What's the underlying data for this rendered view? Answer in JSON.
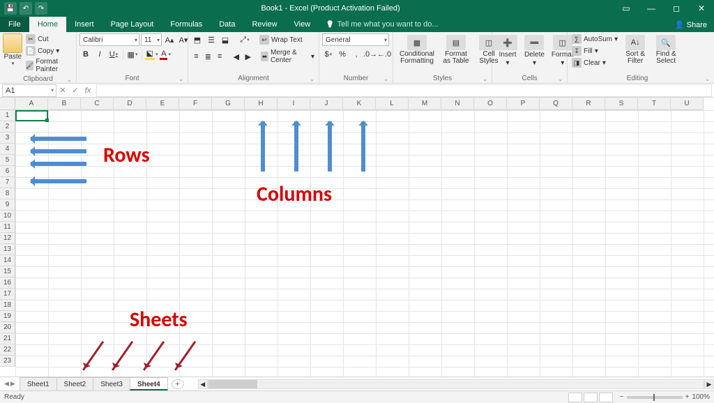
{
  "titlebar": {
    "title": "Book1 - Excel (Product Activation Failed)"
  },
  "tabs": {
    "file": "File",
    "home": "Home",
    "insert": "Insert",
    "pagelayout": "Page Layout",
    "formulas": "Formulas",
    "data": "Data",
    "review": "Review",
    "view": "View",
    "tellme": "Tell me what you want to do...",
    "share": "Share"
  },
  "clipboard": {
    "paste": "Paste",
    "cut": "Cut",
    "copy": "Copy",
    "painter": "Format Painter",
    "label": "Clipboard"
  },
  "font": {
    "name": "Calibri",
    "size": "11",
    "label": "Font"
  },
  "alignment": {
    "wrap": "Wrap Text",
    "merge": "Merge & Center",
    "label": "Alignment"
  },
  "number": {
    "format": "General",
    "label": "Number"
  },
  "styles": {
    "cf": "Conditional Formatting",
    "fat": "Format as Table",
    "cs": "Cell Styles",
    "label": "Styles"
  },
  "cells": {
    "insert": "Insert",
    "delete": "Delete",
    "format": "Format",
    "label": "Cells"
  },
  "editing": {
    "autosum": "AutoSum",
    "fill": "Fill",
    "clear": "Clear",
    "sort": "Sort & Filter",
    "find": "Find & Select",
    "label": "Editing"
  },
  "namebox": "A1",
  "columns": [
    "A",
    "B",
    "C",
    "D",
    "E",
    "F",
    "G",
    "H",
    "I",
    "J",
    "K",
    "L",
    "M",
    "N",
    "O",
    "P",
    "Q",
    "R",
    "S",
    "T",
    "U"
  ],
  "rows": [
    "1",
    "2",
    "3",
    "4",
    "5",
    "6",
    "7",
    "8",
    "9",
    "10",
    "11",
    "12",
    "13",
    "14",
    "15",
    "16",
    "17",
    "18",
    "19",
    "20",
    "21",
    "22",
    "23"
  ],
  "annotations": {
    "rows": "Rows",
    "columns": "Columns",
    "sheets": "Sheets"
  },
  "sheets": [
    "Sheet1",
    "Sheet2",
    "Sheet3",
    "Sheet4"
  ],
  "status": {
    "ready": "Ready",
    "zoom": "100%"
  }
}
